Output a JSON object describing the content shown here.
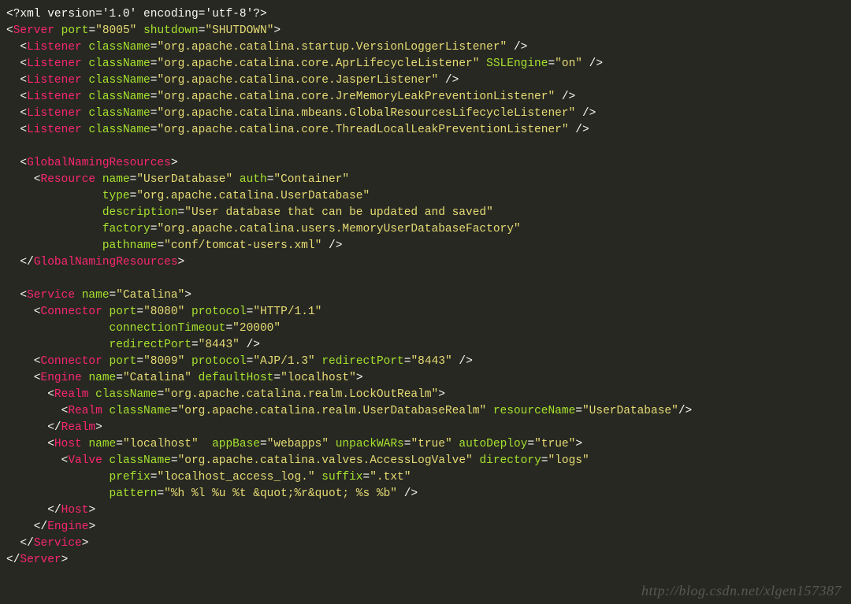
{
  "watermark": "http://blog.csdn.net/xlgen157387",
  "code_lines": [
    [
      [
        "pi",
        "<?"
      ],
      [
        "pi",
        "xml version"
      ],
      [
        "pi",
        "="
      ],
      [
        "pi",
        "'1.0'"
      ],
      [
        "pi",
        " encoding"
      ],
      [
        "pi",
        "="
      ],
      [
        "pi",
        "'utf-8'"
      ],
      [
        "pi",
        "?>"
      ]
    ],
    [
      [
        "br",
        "<"
      ],
      [
        "tag",
        "Server"
      ],
      [
        "br",
        " "
      ],
      [
        "attr",
        "port"
      ],
      [
        "br",
        "="
      ],
      [
        "str",
        "\"8005\""
      ],
      [
        "br",
        " "
      ],
      [
        "attr",
        "shutdown"
      ],
      [
        "br",
        "="
      ],
      [
        "str",
        "\"SHUTDOWN\""
      ],
      [
        "br",
        ">"
      ]
    ],
    [
      [
        "br",
        "  <"
      ],
      [
        "tag",
        "Listener"
      ],
      [
        "br",
        " "
      ],
      [
        "attr",
        "className"
      ],
      [
        "br",
        "="
      ],
      [
        "str",
        "\"org.apache.catalina.startup.VersionLoggerListener\""
      ],
      [
        "br",
        " />"
      ]
    ],
    [
      [
        "br",
        "  <"
      ],
      [
        "tag",
        "Listener"
      ],
      [
        "br",
        " "
      ],
      [
        "attr",
        "className"
      ],
      [
        "br",
        "="
      ],
      [
        "str",
        "\"org.apache.catalina.core.AprLifecycleListener\""
      ],
      [
        "br",
        " "
      ],
      [
        "attr",
        "SSLEngine"
      ],
      [
        "br",
        "="
      ],
      [
        "str",
        "\"on\""
      ],
      [
        "br",
        " />"
      ]
    ],
    [
      [
        "br",
        "  <"
      ],
      [
        "tag",
        "Listener"
      ],
      [
        "br",
        " "
      ],
      [
        "attr",
        "className"
      ],
      [
        "br",
        "="
      ],
      [
        "str",
        "\"org.apache.catalina.core.JasperListener\""
      ],
      [
        "br",
        " />"
      ]
    ],
    [
      [
        "br",
        "  <"
      ],
      [
        "tag",
        "Listener"
      ],
      [
        "br",
        " "
      ],
      [
        "attr",
        "className"
      ],
      [
        "br",
        "="
      ],
      [
        "str",
        "\"org.apache.catalina.core.JreMemoryLeakPreventionListener\""
      ],
      [
        "br",
        " />"
      ]
    ],
    [
      [
        "br",
        "  <"
      ],
      [
        "tag",
        "Listener"
      ],
      [
        "br",
        " "
      ],
      [
        "attr",
        "className"
      ],
      [
        "br",
        "="
      ],
      [
        "str",
        "\"org.apache.catalina.mbeans.GlobalResourcesLifecycleListener\""
      ],
      [
        "br",
        " />"
      ]
    ],
    [
      [
        "br",
        "  <"
      ],
      [
        "tag",
        "Listener"
      ],
      [
        "br",
        " "
      ],
      [
        "attr",
        "className"
      ],
      [
        "br",
        "="
      ],
      [
        "str",
        "\"org.apache.catalina.core.ThreadLocalLeakPreventionListener\""
      ],
      [
        "br",
        " />"
      ]
    ],
    [
      [
        "br",
        ""
      ]
    ],
    [
      [
        "br",
        "  <"
      ],
      [
        "tag",
        "GlobalNamingResources"
      ],
      [
        "br",
        ">"
      ]
    ],
    [
      [
        "br",
        "    <"
      ],
      [
        "tag",
        "Resource"
      ],
      [
        "br",
        " "
      ],
      [
        "attr",
        "name"
      ],
      [
        "br",
        "="
      ],
      [
        "str",
        "\"UserDatabase\""
      ],
      [
        "br",
        " "
      ],
      [
        "attr",
        "auth"
      ],
      [
        "br",
        "="
      ],
      [
        "str",
        "\"Container\""
      ]
    ],
    [
      [
        "br",
        "              "
      ],
      [
        "attr",
        "type"
      ],
      [
        "br",
        "="
      ],
      [
        "str",
        "\"org.apache.catalina.UserDatabase\""
      ]
    ],
    [
      [
        "br",
        "              "
      ],
      [
        "attr",
        "description"
      ],
      [
        "br",
        "="
      ],
      [
        "str",
        "\"User database that can be updated and saved\""
      ]
    ],
    [
      [
        "br",
        "              "
      ],
      [
        "attr",
        "factory"
      ],
      [
        "br",
        "="
      ],
      [
        "str",
        "\"org.apache.catalina.users.MemoryUserDatabaseFactory\""
      ]
    ],
    [
      [
        "br",
        "              "
      ],
      [
        "attr",
        "pathname"
      ],
      [
        "br",
        "="
      ],
      [
        "str",
        "\"conf/tomcat-users.xml\""
      ],
      [
        "br",
        " />"
      ]
    ],
    [
      [
        "br",
        "  </"
      ],
      [
        "tag",
        "GlobalNamingResources"
      ],
      [
        "br",
        ">"
      ]
    ],
    [
      [
        "br",
        ""
      ]
    ],
    [
      [
        "br",
        "  <"
      ],
      [
        "tag",
        "Service"
      ],
      [
        "br",
        " "
      ],
      [
        "attr",
        "name"
      ],
      [
        "br",
        "="
      ],
      [
        "str",
        "\"Catalina\""
      ],
      [
        "br",
        ">"
      ]
    ],
    [
      [
        "br",
        "    <"
      ],
      [
        "tag",
        "Connector"
      ],
      [
        "br",
        " "
      ],
      [
        "attr",
        "port"
      ],
      [
        "br",
        "="
      ],
      [
        "str",
        "\"8080\""
      ],
      [
        "br",
        " "
      ],
      [
        "attr",
        "protocol"
      ],
      [
        "br",
        "="
      ],
      [
        "str",
        "\"HTTP/1.1\""
      ]
    ],
    [
      [
        "br",
        "               "
      ],
      [
        "attr",
        "connectionTimeout"
      ],
      [
        "br",
        "="
      ],
      [
        "str",
        "\"20000\""
      ]
    ],
    [
      [
        "br",
        "               "
      ],
      [
        "attr",
        "redirectPort"
      ],
      [
        "br",
        "="
      ],
      [
        "str",
        "\"8443\""
      ],
      [
        "br",
        " />"
      ]
    ],
    [
      [
        "br",
        "    <"
      ],
      [
        "tag",
        "Connector"
      ],
      [
        "br",
        " "
      ],
      [
        "attr",
        "port"
      ],
      [
        "br",
        "="
      ],
      [
        "str",
        "\"8009\""
      ],
      [
        "br",
        " "
      ],
      [
        "attr",
        "protocol"
      ],
      [
        "br",
        "="
      ],
      [
        "str",
        "\"AJP/1.3\""
      ],
      [
        "br",
        " "
      ],
      [
        "attr",
        "redirectPort"
      ],
      [
        "br",
        "="
      ],
      [
        "str",
        "\"8443\""
      ],
      [
        "br",
        " />"
      ]
    ],
    [
      [
        "br",
        "    <"
      ],
      [
        "tag",
        "Engine"
      ],
      [
        "br",
        " "
      ],
      [
        "attr",
        "name"
      ],
      [
        "br",
        "="
      ],
      [
        "str",
        "\"Catalina\""
      ],
      [
        "br",
        " "
      ],
      [
        "attr",
        "defaultHost"
      ],
      [
        "br",
        "="
      ],
      [
        "str",
        "\"localhost\""
      ],
      [
        "br",
        ">"
      ]
    ],
    [
      [
        "br",
        "      <"
      ],
      [
        "tag",
        "Realm"
      ],
      [
        "br",
        " "
      ],
      [
        "attr",
        "className"
      ],
      [
        "br",
        "="
      ],
      [
        "str",
        "\"org.apache.catalina.realm.LockOutRealm\""
      ],
      [
        "br",
        ">"
      ]
    ],
    [
      [
        "br",
        "        <"
      ],
      [
        "tag",
        "Realm"
      ],
      [
        "br",
        " "
      ],
      [
        "attr",
        "className"
      ],
      [
        "br",
        "="
      ],
      [
        "str",
        "\"org.apache.catalina.realm.UserDatabaseRealm\""
      ],
      [
        "br",
        " "
      ],
      [
        "attr",
        "resourceName"
      ],
      [
        "br",
        "="
      ],
      [
        "str",
        "\"UserDatabase\""
      ],
      [
        "br",
        "/>"
      ]
    ],
    [
      [
        "br",
        "      </"
      ],
      [
        "tag",
        "Realm"
      ],
      [
        "br",
        ">"
      ]
    ],
    [
      [
        "br",
        "      <"
      ],
      [
        "tag",
        "Host"
      ],
      [
        "br",
        " "
      ],
      [
        "attr",
        "name"
      ],
      [
        "br",
        "="
      ],
      [
        "str",
        "\"localhost\""
      ],
      [
        "br",
        "  "
      ],
      [
        "attr",
        "appBase"
      ],
      [
        "br",
        "="
      ],
      [
        "str",
        "\"webapps\""
      ],
      [
        "br",
        " "
      ],
      [
        "attr",
        "unpackWARs"
      ],
      [
        "br",
        "="
      ],
      [
        "str",
        "\"true\""
      ],
      [
        "br",
        " "
      ],
      [
        "attr",
        "autoDeploy"
      ],
      [
        "br",
        "="
      ],
      [
        "str",
        "\"true\""
      ],
      [
        "br",
        ">"
      ]
    ],
    [
      [
        "br",
        "        <"
      ],
      [
        "tag",
        "Valve"
      ],
      [
        "br",
        " "
      ],
      [
        "attr",
        "className"
      ],
      [
        "br",
        "="
      ],
      [
        "str",
        "\"org.apache.catalina.valves.AccessLogValve\""
      ],
      [
        "br",
        " "
      ],
      [
        "attr",
        "directory"
      ],
      [
        "br",
        "="
      ],
      [
        "str",
        "\"logs\""
      ]
    ],
    [
      [
        "br",
        "               "
      ],
      [
        "attr",
        "prefix"
      ],
      [
        "br",
        "="
      ],
      [
        "str",
        "\"localhost_access_log.\""
      ],
      [
        "br",
        " "
      ],
      [
        "attr",
        "suffix"
      ],
      [
        "br",
        "="
      ],
      [
        "str",
        "\".txt\""
      ]
    ],
    [
      [
        "br",
        "               "
      ],
      [
        "attr",
        "pattern"
      ],
      [
        "br",
        "="
      ],
      [
        "str",
        "\"%h %l %u %t &quot;%r&quot; %s %b\""
      ],
      [
        "br",
        " />"
      ]
    ],
    [
      [
        "br",
        "      </"
      ],
      [
        "tag",
        "Host"
      ],
      [
        "br",
        ">"
      ]
    ],
    [
      [
        "br",
        "    </"
      ],
      [
        "tag",
        "Engine"
      ],
      [
        "br",
        ">"
      ]
    ],
    [
      [
        "br",
        "  </"
      ],
      [
        "tag",
        "Service"
      ],
      [
        "br",
        ">"
      ]
    ],
    [
      [
        "br",
        "</"
      ],
      [
        "tag",
        "Server"
      ],
      [
        "br",
        ">"
      ]
    ]
  ]
}
